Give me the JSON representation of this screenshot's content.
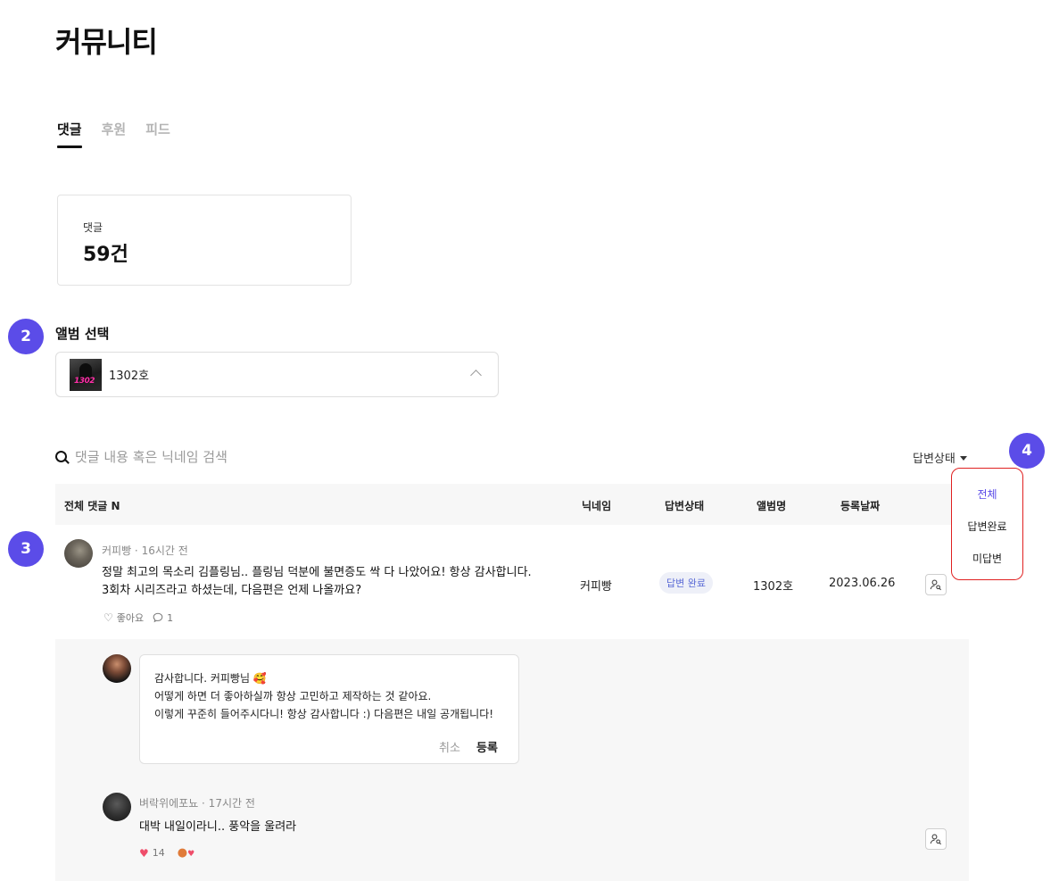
{
  "page": {
    "title": "커뮤니티"
  },
  "tabs": [
    {
      "label": "댓글",
      "active": true
    },
    {
      "label": "후원",
      "active": false
    },
    {
      "label": "피드",
      "active": false
    }
  ],
  "stat": {
    "label": "댓글",
    "value": "59건"
  },
  "markers": [
    "2",
    "3",
    "4"
  ],
  "album": {
    "label": "앨범 선택",
    "selected": "1302호",
    "thumb_text": "1302"
  },
  "search": {
    "placeholder": "댓글 내용 혹은 닉네임 검색"
  },
  "status_filter": {
    "label": "답변상태",
    "options": [
      "전체",
      "답변완료",
      "미답변"
    ],
    "selected": "전체"
  },
  "table": {
    "headers": {
      "all": "전체 댓글 N",
      "nickname": "닉네임",
      "status": "답변상태",
      "album": "앨범명",
      "date": "등록날짜"
    }
  },
  "comments": [
    {
      "author": "커피빵",
      "time": "16시간 전",
      "meta": "커피빵 · 16시간 전",
      "lines": [
        "정말 최고의 목소리 김플링님.. 플링님 덕분에 불면증도 싹 다 나았어요! 항상 감사합니다.",
        "3회차 시리즈라고 하셨는데, 다음편은 언제 나올까요?"
      ],
      "like_label": "좋아요",
      "reply_count": "1",
      "nickname": "커피빵",
      "status": "답변 완료",
      "album": "1302호",
      "date": "2023.06.26"
    }
  ],
  "reply": {
    "lines": [
      "감사합니다. 커피빵님 🥰",
      "어떻게 하면 더 좋아하실까 항상 고민하고 제작하는 것 같아요.",
      "이렇게 꾸준히 들어주시다니! 항상 감사합니다 :) 다음편은 내일 공개됩니다!"
    ],
    "cancel": "취소",
    "submit": "등록"
  },
  "comment2": {
    "meta": "벼락위에포뇨 · 17시간 전",
    "text": "대박 내일이라니.. 풍악을 울려라",
    "likes": "14"
  },
  "colors": {
    "accent": "#5b4ce8",
    "dropdown_border": "#e02020",
    "badge_text": "#5b6bd6"
  }
}
